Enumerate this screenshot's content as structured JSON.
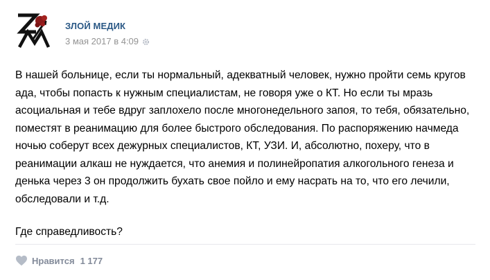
{
  "header": {
    "author": "ЗЛОЙ МЕДИК",
    "date": "3 мая 2017 в 4:09",
    "avatar_icon": "zm-logo-icon",
    "settings_icon": "gear-icon"
  },
  "post": {
    "paragraphs": [
      "В нашей больнице, если ты нормальный, адекватный человек, нужно пройти семь кругов ада, чтобы попасть к нужным специалистам, не говоря уже о КТ. Но если ты мразь асоциальная и тебе вдруг заплохело после многонедельного запоя, то тебя, обязательно, поместят в реанимацию для более быстрого обследования. По распоряжению начмеда ночью соберут всех дежурных специалистов, КТ, УЗИ. И, абсолютно, похеру, что в реанимации алкаш не нуждается, что анемия и полинейропатия алкогольного генеза и денька через 3 он продолжить бухать свое пойло и ему насрать на то, что его лечили, обследовали и т.д.",
      "Где справедливость?"
    ]
  },
  "footer": {
    "like_label": "Нравится",
    "like_count": "1 177",
    "like_icon": "heart-icon"
  },
  "colors": {
    "author": "#2a5885",
    "meta": "#939393",
    "like": "#828a99",
    "avatar_accent": "#8b1a1a"
  }
}
